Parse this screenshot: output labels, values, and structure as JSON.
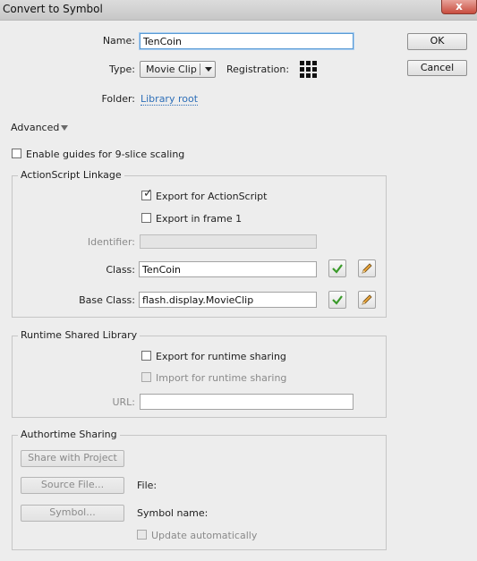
{
  "window": {
    "title": "Convert to Symbol",
    "close_glyph": "x"
  },
  "name": {
    "label": "Name:",
    "value": "TenCoin"
  },
  "type": {
    "label": "Type:",
    "value": "Movie Clip"
  },
  "registration": {
    "label": "Registration:"
  },
  "folder": {
    "label": "Folder:",
    "value": "Library root"
  },
  "buttons": {
    "ok": "OK",
    "cancel": "Cancel"
  },
  "advanced": {
    "label": "Advanced"
  },
  "nine_slice": {
    "label": "Enable guides for 9-slice scaling",
    "checked": false
  },
  "actionscript_linkage": {
    "title": "ActionScript Linkage",
    "export_for_actionscript": {
      "label": "Export for ActionScript",
      "checked": true
    },
    "export_in_frame1": {
      "label": "Export in frame 1",
      "checked": false
    },
    "identifier": {
      "label": "Identifier:",
      "value": ""
    },
    "class": {
      "label": "Class:",
      "value": "TenCoin"
    },
    "base_class": {
      "label": "Base Class:",
      "value": "flash.display.MovieClip"
    }
  },
  "runtime_shared_library": {
    "title": "Runtime Shared Library",
    "export_for_runtime_sharing": {
      "label": "Export for runtime sharing",
      "checked": false
    },
    "import_for_runtime_sharing": {
      "label": "Import for runtime sharing",
      "checked": false
    },
    "url": {
      "label": "URL:",
      "value": ""
    }
  },
  "authortime_sharing": {
    "title": "Authortime Sharing",
    "share_with_project": "Share with Project",
    "source_file_button": "Source File...",
    "file_label": "File:",
    "symbol_button": "Symbol...",
    "symbol_name_label": "Symbol name:",
    "update_automatically": {
      "label": "Update automatically",
      "checked": false
    }
  },
  "colors": {
    "validate_check": "#3a9a2a",
    "pencil": "#d88a1c",
    "link": "#2e6fb8"
  }
}
